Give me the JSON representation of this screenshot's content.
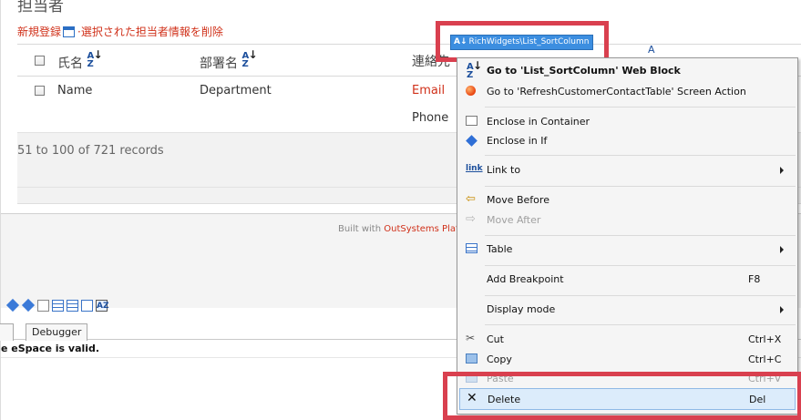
{
  "section": {
    "title": "担当者",
    "new_link": "新規登録",
    "separator": "·",
    "delete_link": "選択された担当者情報を削除"
  },
  "table": {
    "headers": [
      "氏名",
      "部署名",
      "連絡先"
    ],
    "partial_header_fragment": "A",
    "row": {
      "name": "Name",
      "department": "Department",
      "email": "Email",
      "phone": "Phone"
    },
    "records": "51 to 100 of 721 records"
  },
  "footer": {
    "built_with": "Built with ",
    "brand": "OutSystems Plat"
  },
  "widget_chip": {
    "label": "RichWidgets\\List_SortColumn",
    "icon": "sort-az-icon"
  },
  "bottom_pane": {
    "tabs": [
      "",
      "Debugger"
    ],
    "message": "e eSpace is valid."
  },
  "context_menu": {
    "items": [
      {
        "label": "Go to 'List_SortColumn' Web Block",
        "icon": "sort-az-icon",
        "bold": true
      },
      {
        "label": "Go to 'RefreshCustomerContactTable' Screen Action",
        "icon": "orb-icon"
      },
      {
        "label": "Enclose in Container",
        "icon": "container-icon"
      },
      {
        "label": "Enclose in If",
        "icon": "diamond-icon"
      },
      {
        "label": "Link to",
        "icon": "link-icon",
        "submenu": true
      },
      {
        "label": "Move Before",
        "icon": "arrow-left-icon"
      },
      {
        "label": "Move After",
        "icon": "arrow-right-icon",
        "disabled": true
      },
      {
        "label": "Table",
        "icon": "table-icon",
        "submenu": true
      },
      {
        "label": "Add Breakpoint",
        "shortcut": "F8"
      },
      {
        "label": "Display mode",
        "submenu": true
      },
      {
        "label": "Cut",
        "icon": "scissors-icon",
        "shortcut": "Ctrl+X"
      },
      {
        "label": "Copy",
        "icon": "copy-icon",
        "shortcut": "Ctrl+C"
      },
      {
        "label": "Paste",
        "icon": "paste-icon",
        "shortcut": "Ctrl+V",
        "disabled": true
      },
      {
        "label": "Delete",
        "icon": "delete-x-icon",
        "shortcut": "Del",
        "active": true
      }
    ],
    "link_icon_text": "link"
  },
  "colors": {
    "accent_red": "#d0311a",
    "highlight_box": "#d9404f",
    "chip_blue": "#3c8ee0",
    "menu_active": "#dcecfb"
  }
}
